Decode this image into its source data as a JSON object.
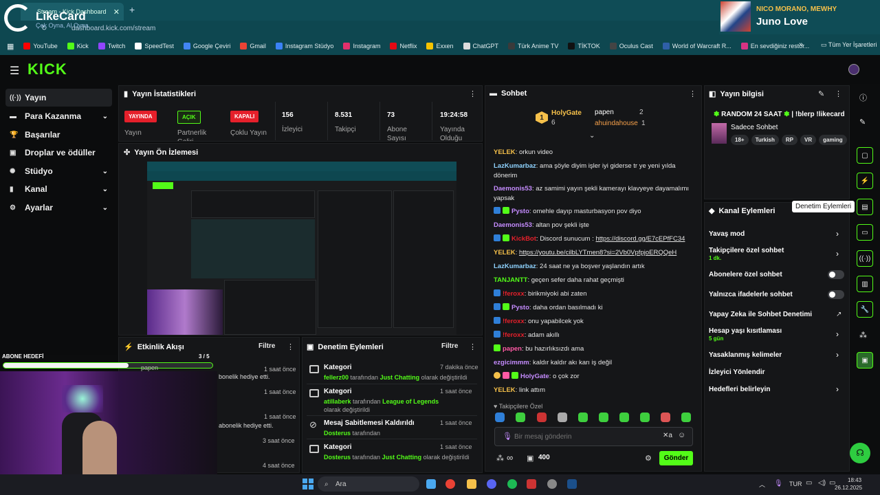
{
  "browser": {
    "tab_title": "Stream - Kick Dashboard",
    "url": "dashboard.kick.com/stream",
    "overlay_logo": "LikeCard",
    "overlay_logo_sub": "Çek Oyna, Al Oyna",
    "bookmarks": [
      {
        "label": "YouTube",
        "color": "#ff0000"
      },
      {
        "label": "Kick",
        "color": "#53fc18"
      },
      {
        "label": "Twitch",
        "color": "#9146ff"
      },
      {
        "label": "SpeedTest",
        "color": "#ffffff"
      },
      {
        "label": "Google Çeviri",
        "color": "#4285f4"
      },
      {
        "label": "Gmail",
        "color": "#ea4335"
      },
      {
        "label": "Instagram Stüdyo",
        "color": "#3b82f6"
      },
      {
        "label": "Instagram",
        "color": "#e1306c"
      },
      {
        "label": "Netflix",
        "color": "#e50914"
      },
      {
        "label": "Exxen",
        "color": "#f5c400"
      },
      {
        "label": "ChatGPT",
        "color": "#dddddd"
      },
      {
        "label": "Türk Anime TV",
        "color": "#3a3a3a"
      },
      {
        "label": "TİKTOK",
        "color": "#111111"
      },
      {
        "label": "Oculus Cast",
        "color": "#444444"
      },
      {
        "label": "World of Warcraft R...",
        "color": "#2f5fa8"
      },
      {
        "label": "En sevdiğiniz restor...",
        "color": "#d63384"
      }
    ],
    "all_bookmarks": "Tüm Yer İşaretleri"
  },
  "now_playing": {
    "artist": "NICO MORANO, MEWHY",
    "title": "Juno Love"
  },
  "sidebar": {
    "items": [
      {
        "label": "Yayın",
        "icon": "broadcast-icon"
      },
      {
        "label": "Para Kazanma",
        "icon": "money-icon"
      },
      {
        "label": "Başarılar",
        "icon": "trophy-icon"
      },
      {
        "label": "Droplar ve ödüller",
        "icon": "gift-icon"
      },
      {
        "label": "Stüdyo",
        "icon": "gear-icon"
      },
      {
        "label": "Kanal",
        "icon": "chart-icon"
      },
      {
        "label": "Ayarlar",
        "icon": "settings-icon"
      }
    ]
  },
  "stats": {
    "title": "Yayın İstatistikleri",
    "badges": [
      {
        "value": "YAYINDA",
        "label": "Yayın",
        "color": "#e5202b"
      },
      {
        "value": "AÇIK",
        "label": "Partnerlik Geliri",
        "color": "#53fc18"
      },
      {
        "value": "KAPALI",
        "label": "Çoklu Yayın",
        "color": "#e5202b"
      }
    ],
    "numbers": [
      {
        "value": "156",
        "label": "İzleyici"
      },
      {
        "value": "8.531",
        "label": "Takipçi"
      },
      {
        "value": "73",
        "label": "Abone Sayısı"
      },
      {
        "value": "19:24:58",
        "label": "Yayında Olduğu"
      }
    ]
  },
  "preview": {
    "title": "Yayın Ön İzlemesi"
  },
  "events": {
    "title": "Etkinlik Akışı",
    "filter": "Filtre",
    "items": [
      {
        "time": "1 saat önce",
        "text": "bonelik hediye etti."
      },
      {
        "time": "1 saat önce",
        "text": ""
      },
      {
        "time": "1 saat önce",
        "text": "abonelik hediye etti."
      },
      {
        "time": "3 saat önce",
        "text": ""
      },
      {
        "time": "4 saat önce",
        "text": ""
      }
    ]
  },
  "mod_actions": {
    "title": "Denetim Eylemleri",
    "filter": "Filtre",
    "items": [
      {
        "title": "Kategori",
        "time": "7 dakika önce",
        "user": "fellerz00",
        "mid": " tarafından ",
        "target": "Just Chatting",
        "tail": " olarak değiştirildi"
      },
      {
        "title": "Kategori",
        "time": "1 saat önce",
        "user": "atillaberk",
        "mid": " tarafından ",
        "target": "League of Legends",
        "tail": " olarak değiştirildi"
      },
      {
        "title": "Mesaj Sabitlemesi Kaldırıldı",
        "time": "1 saat önce",
        "user": "Dosterus",
        "mid": " tarafından",
        "target": "",
        "tail": ""
      },
      {
        "title": "Kategori",
        "time": "1 saat önce",
        "user": "Dosterus",
        "mid": " tarafından ",
        "target": "Just Chatting",
        "tail": " olarak değiştirildi"
      }
    ]
  },
  "chat": {
    "title": "Sohbet",
    "top": [
      {
        "rank": "1",
        "name": "HolyGate",
        "count": "6"
      },
      {
        "rank": "",
        "name": "papen",
        "count": "2"
      },
      {
        "rank": "",
        "name": "ahuindahouse",
        "count": "1"
      }
    ],
    "messages": [
      {
        "user": "YELEK",
        "color": "#f5c04a",
        "text": "orkun video",
        "link": ""
      },
      {
        "user": "LazKumarbaz",
        "color": "#8fd3ff",
        "text": "ama şöyle diyim işler iyi giderse tr ye yeni yılda dönerim",
        "link": ""
      },
      {
        "user": "Daemonis53",
        "color": "#c58cff",
        "text": "az samimi yayın şekli kamerayı klavyeye dayamalımı yapsak",
        "link": ""
      },
      {
        "user": "Pysto",
        "color": "#c58cff",
        "text": "omehle dayıp masturbasyon pov diyo",
        "link": ""
      },
      {
        "user": "Daemonis53",
        "color": "#c58cff",
        "text": "altan pov şekli işte",
        "link": ""
      },
      {
        "user": "KickBot",
        "color": "#e5202b",
        "text": "Discord sunucum : ",
        "link": "https://discord.gg/E7cEPfFC34"
      },
      {
        "user": "YELEK",
        "color": "#f5c04a",
        "text": "",
        "link": "https://youtu.be/cilbLYTmen8?si=2Vb0VpfpjoERQQeH"
      },
      {
        "user": "LazKumarbaz",
        "color": "#8fd3ff",
        "text": "24 saat ne ya boşver yaşlandın artık",
        "link": ""
      },
      {
        "user": "TANJANTT",
        "color": "#53fc18",
        "text": "geçen sefer daha rahat geçmişti",
        "link": ""
      },
      {
        "user": "!feroxx",
        "color": "#e5202b",
        "text": "birikmiyoki abi zaten",
        "link": ""
      },
      {
        "user": "Pysto",
        "color": "#c58cff",
        "text": "daha ordan basılmadı ki",
        "link": ""
      },
      {
        "user": "!feroxx",
        "color": "#e5202b",
        "text": "onu yapabilcek yok",
        "link": ""
      },
      {
        "user": "!feroxx",
        "color": "#e5202b",
        "text": "adam akıllı",
        "link": ""
      },
      {
        "user": "papen",
        "color": "#ff5aa5",
        "text": "bu hazırlıksızdı ama",
        "link": ""
      },
      {
        "user": "ezgicimmm",
        "color": "#c58cff",
        "text": "kaldır kaldır akı karı iş değil",
        "link": ""
      },
      {
        "user": "HolyGate",
        "color": "#c58cff",
        "text": "o çok zor",
        "link": ""
      },
      {
        "user": "YELEK",
        "color": "#f5c04a",
        "text": "link attım",
        "link": ""
      }
    ],
    "follower_only": "Takipçilere Özel",
    "placeholder": "Bir mesaj gönderin",
    "points": "400",
    "infinity": "∞",
    "send": "Gönder"
  },
  "stream_info": {
    "title": "Yayın bilgisi",
    "stream_title": "RANDOM 24 SAAT",
    "stream_title_tail": "| !blerp !likecard",
    "category": "Sadece Sohbet",
    "tags": [
      "18+",
      "Turkish",
      "RP",
      "VR",
      "gaming"
    ]
  },
  "channel_actions": {
    "title": "Kanal Eylemleri",
    "tooltip": "Denetim Eylemleri",
    "items": [
      {
        "label": "Yavaş mod",
        "sub": "",
        "control": "chevron"
      },
      {
        "label": "Takipçilere özel sohbet",
        "sub": "1 dk.",
        "control": "chevron"
      },
      {
        "label": "Abonelere özel sohbet",
        "sub": "",
        "control": "toggle"
      },
      {
        "label": "Yalnızca ifadelerle sohbet",
        "sub": "",
        "control": "toggle"
      },
      {
        "label": "Yapay Zeka ile Sohbet Denetimi",
        "sub": "",
        "control": "external"
      },
      {
        "label": "Hesap yaşı kısıtlaması",
        "sub": "5 gün",
        "control": "chevron"
      },
      {
        "label": "Yasaklanmış kelimeler",
        "sub": "",
        "control": "chevron"
      },
      {
        "label": "İzleyici Yönlendir",
        "sub": "",
        "control": "none"
      },
      {
        "label": "Hedefleri belirleyin",
        "sub": "",
        "control": "chevron"
      }
    ]
  },
  "goal": {
    "label": "ABONE HEDEFİ",
    "progress": "3 / 5",
    "progress_fraction": 0.6,
    "user": "papen"
  },
  "taskbar": {
    "search": "Ara",
    "lang": "TUR",
    "time": "18:43",
    "date": "26.12.2025"
  }
}
